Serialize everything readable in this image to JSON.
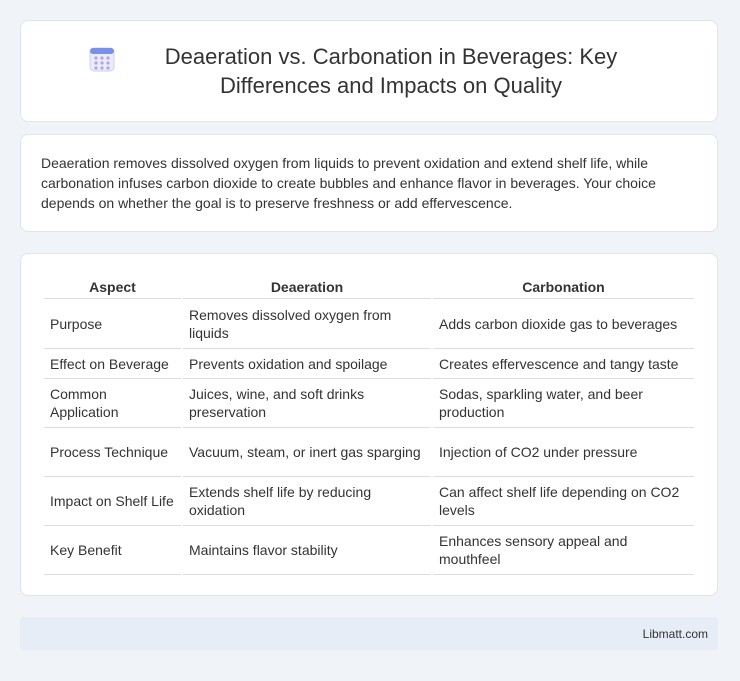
{
  "header": {
    "title": "Deaeration vs. Carbonation in Beverages: Key Differences and Impacts on Quality",
    "icon": "calendar-icon"
  },
  "intro": {
    "text": "Deaeration removes dissolved oxygen from liquids to prevent oxidation and extend shelf life, while carbonation infuses carbon dioxide to create bubbles and enhance flavor in beverages. Your choice depends on whether the goal is to preserve freshness or add effervescence."
  },
  "table": {
    "headers": [
      "Aspect",
      "Deaeration",
      "Carbonation"
    ],
    "rows": [
      [
        "Purpose",
        "Removes dissolved oxygen from liquids",
        "Adds carbon dioxide gas to beverages"
      ],
      [
        "Effect on Beverage",
        "Prevents oxidation and spoilage",
        "Creates effervescence and tangy taste"
      ],
      [
        "Common Application",
        "Juices, wine, and soft drinks preservation",
        "Sodas, sparkling water, and beer production"
      ],
      [
        "Process Technique",
        "Vacuum, steam, or inert gas sparging",
        "Injection of CO2 under pressure"
      ],
      [
        "Impact on Shelf Life",
        "Extends shelf life by reducing oxidation",
        "Can affect shelf life depending on CO2 levels"
      ],
      [
        "Key Benefit",
        "Maintains flavor stability",
        "Enhances sensory appeal and mouthfeel"
      ]
    ]
  },
  "footer": {
    "brand": "Libmatt.com"
  },
  "colors": {
    "background": "#f0f3f8",
    "footer_bg": "#e6edf7",
    "icon_accent": "#7b8ee8"
  }
}
